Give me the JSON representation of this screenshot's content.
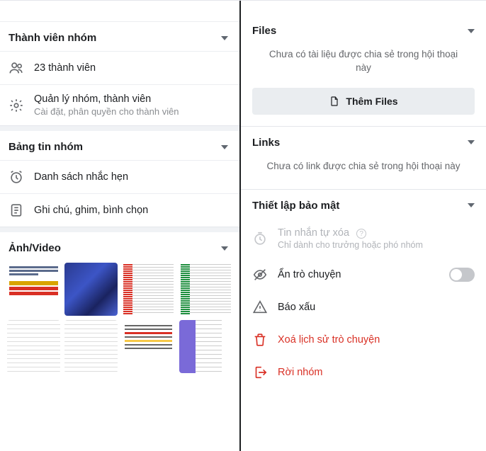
{
  "left": {
    "members_section": {
      "title": "Thành viên nhóm",
      "count_label": "23 thành viên",
      "manage_title": "Quản lý nhóm, thành viên",
      "manage_sub": "Cài đặt, phân quyền cho thành viên"
    },
    "board_section": {
      "title": "Bảng tin nhóm",
      "reminders": "Danh sách nhắc hẹn",
      "notes": "Ghi chú, ghim, bình chọn"
    },
    "media_section": {
      "title": "Ảnh/Video"
    }
  },
  "right": {
    "files": {
      "title": "Files",
      "empty": "Chưa có tài liệu được chia sẻ trong hội thoại này",
      "add_btn": "Thêm Files"
    },
    "links": {
      "title": "Links",
      "empty": "Chưa có link được chia sẻ trong hội thoại này"
    },
    "security": {
      "title": "Thiết lập bảo mật",
      "auto_delete_title": "Tin nhắn tự xóa",
      "auto_delete_sub": "Chỉ dành cho trưởng hoặc phó nhóm",
      "hide_chat": "Ẩn trò chuyện",
      "report": "Báo xấu",
      "clear_history": "Xoá lịch sử trò chuyện",
      "leave_group": "Rời nhóm"
    }
  }
}
